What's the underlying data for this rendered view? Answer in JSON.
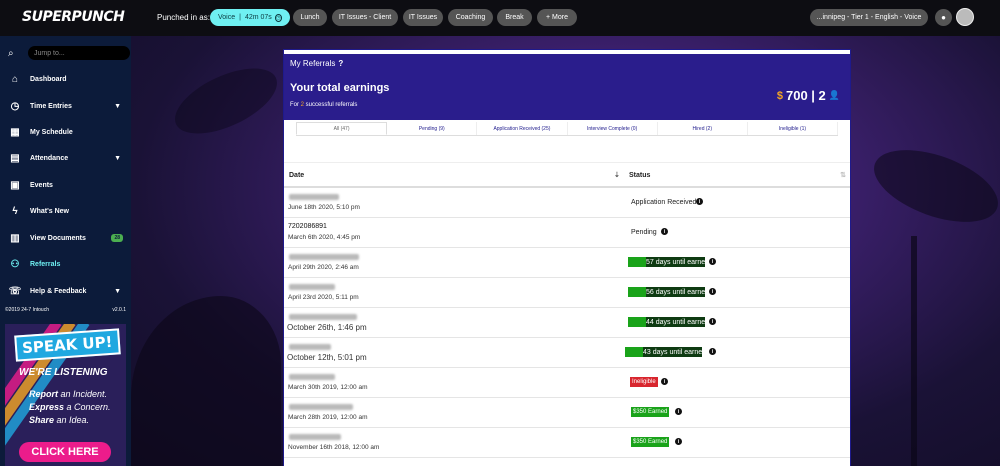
{
  "topbar": {
    "logo": "SUPERPUNCH",
    "punched_label": "Punched in as:",
    "active_status": "Voice",
    "active_timer": "42m 07s",
    "buttons": [
      "Lunch",
      "IT Issues - Client",
      "IT Issues",
      "Coaching",
      "Break",
      "+ More"
    ],
    "location": "...innipeg - Tier 1 - English - Voice"
  },
  "sidebar": {
    "search_placeholder": "Jump to...",
    "items": [
      {
        "label": "Dashboard",
        "icon": "home-icon"
      },
      {
        "label": "Time Entries",
        "icon": "clock-icon",
        "expandable": true
      },
      {
        "label": "My Schedule",
        "icon": "calendar-icon"
      },
      {
        "label": "Attendance",
        "icon": "attendance-icon",
        "expandable": true
      },
      {
        "label": "Events",
        "icon": "events-icon"
      },
      {
        "label": "What's New",
        "icon": "lightning-icon"
      },
      {
        "label": "View Documents",
        "icon": "documents-icon",
        "badge": "28"
      },
      {
        "label": "Referrals",
        "icon": "referrals-icon",
        "active": true
      },
      {
        "label": "Help & Feedback",
        "icon": "help-icon",
        "expandable": true
      }
    ],
    "copyright": "©2019 24-7 Intouch",
    "version": "v2.0.1"
  },
  "ad": {
    "speak_up": "SPEAK UP!",
    "listening": "WE'RE LISTENING",
    "line1_bold": "Report",
    "line1": " an Incident.",
    "line2_bold": "Express",
    "line2": " a Concern.",
    "line3_bold": "Share",
    "line3": " an Idea.",
    "cta": "CLICK HERE"
  },
  "panel": {
    "title": "My Referrals",
    "help": "?",
    "earnings_title": "Your total earnings",
    "earnings_sub_pre": "For ",
    "earnings_sub_count": "2",
    "earnings_sub_post": " successful referrals",
    "dollar": "$",
    "total": "700 | 2",
    "tabs": [
      "All (47)",
      "Pending (9)",
      "Application Received (25)",
      "Interview Complete (0)",
      "Hired (2)",
      "Ineligible (1)"
    ],
    "col_date": "Date",
    "col_status": "Status",
    "rows": [
      {
        "name_width": 50,
        "date": "June 18th 2020, 5:10 pm",
        "big": false,
        "status": "Application Received",
        "type": "text"
      },
      {
        "name": "7202086891",
        "date": "March 6th 2020, 4:45 pm",
        "big": false,
        "status": "Pending",
        "type": "text"
      },
      {
        "name_width": 70,
        "date": "April 29th 2020, 2:46 am",
        "big": false,
        "status": "57 days until earned",
        "type": "dark"
      },
      {
        "name_width": 46,
        "date": "April 23rd 2020, 5:11 pm",
        "big": false,
        "status": "56 days until earned",
        "type": "dark"
      },
      {
        "name_width": 68,
        "date": "October 26th, 1:46 pm",
        "big": true,
        "status": "44 days until earned",
        "type": "dark"
      },
      {
        "name_width": 42,
        "date": "October 12th, 5:01 pm",
        "big": true,
        "status": "43 days until earned",
        "type": "dark"
      },
      {
        "name_width": 46,
        "date": "March 30th 2019, 12:00 am",
        "big": false,
        "status": "Ineligible",
        "type": "red"
      },
      {
        "name_width": 64,
        "date": "March 28th 2019, 12:00 am",
        "big": false,
        "status": "$350 Earned",
        "type": "green"
      },
      {
        "name_width": 52,
        "date": "November 16th 2018, 12:00 am",
        "big": false,
        "status": "$350 Earned",
        "type": "green"
      }
    ]
  }
}
